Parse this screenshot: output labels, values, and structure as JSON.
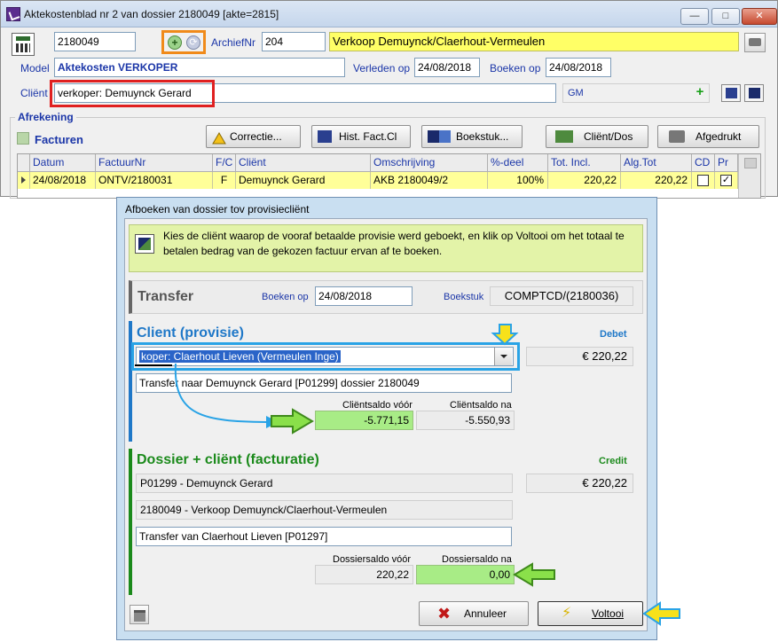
{
  "window": {
    "title": "Aktekostenblad nr 2 van dossier 2180049 [akte=2815]",
    "min_label": "0",
    "max_label": "1",
    "close_label": "r"
  },
  "header": {
    "dossier_nr": "2180049",
    "archief_label": "ArchiefNr",
    "archief_nr": "204",
    "dossier_title": "Verkoop Demuynck/Claerhout-Vermeulen",
    "model_label": "Model",
    "model_value": "Aktekosten VERKOPER",
    "verleden_label": "Verleden op",
    "verleden_value": "24/08/2018",
    "boeken_label": "Boeken op",
    "boeken_value": "24/08/2018",
    "client_label": "Cliënt",
    "client_value": "verkoper: Demuynck Gerard",
    "client_code": "GM"
  },
  "afrekening": {
    "group_label": "Afrekening",
    "facturen_label": "Facturen",
    "buttons": {
      "correctie": "Correctie...",
      "hist": "Hist. Fact.Cl",
      "boekstuk": "Boekstuk...",
      "client_dos": "Cliënt/Dos",
      "afgedrukt": "Afgedrukt"
    },
    "columns": [
      "Datum",
      "FactuurNr",
      "F/C",
      "Cliënt",
      "Omschrijving",
      "%-deel",
      "Tot. Incl.",
      "Alg.Tot",
      "CD",
      "Pr"
    ],
    "row": {
      "datum": "24/08/2018",
      "factuurnr": "ONTV/2180031",
      "fc": "F",
      "client": "Demuynck Gerard",
      "omschrijving": "AKB 2180049/2",
      "deel": "100%",
      "tot_incl": "220,22",
      "alg_tot": "220,22",
      "cd": false,
      "pr": true
    }
  },
  "dialog": {
    "title": "Afboeken van dossier tov provisiecliënt",
    "info": "Kies de cliënt waarop de vooraf betaalde provisie werd geboekt, en klik op Voltooi om het totaal te betalen bedrag van de gekozen factuur ervan af te boeken.",
    "transfer_label": "Transfer",
    "boeken_label": "Boeken op",
    "boeken_value": "24/08/2018",
    "boekstuk_label": "Boekstuk",
    "boekstuk_value": "COMPTCD/(2180036)",
    "client_section": {
      "title": "Client (provisie)",
      "debet_label": "Debet",
      "selected_client": "koper: Claerhout Lieven (Vermeulen Inge)",
      "debet_value": "€ 220,22",
      "description": "Transfer naar Demuynck Gerard [P01299] dossier 2180049",
      "saldo_voor_label": "Cliëntsaldo vóór",
      "saldo_na_label": "Cliëntsaldo na",
      "saldo_voor": "-5.771,15",
      "saldo_na": "-5.550,93"
    },
    "dossier_section": {
      "title": "Dossier + cliënt (facturatie)",
      "credit_label": "Credit",
      "client": "P01299 - Demuynck Gerard",
      "credit_value": "€ 220,22",
      "dossier": "2180049 - Verkoop Demuynck/Claerhout-Vermeulen",
      "description": "Transfer van Claerhout Lieven [P01297]",
      "saldo_voor_label": "Dossiersaldo vóór",
      "saldo_na_label": "Dossiersaldo na",
      "saldo_voor": "220,22",
      "saldo_na": "0,00"
    },
    "cancel_label": "Annuleer",
    "finish_label": "Voltooi"
  },
  "colors": {
    "highlight_yellow": "#ffff99",
    "green_field": "#a8ec86",
    "callout_blue": "#29a3e6",
    "callout_red": "#e02020",
    "callout_orange": "#f08a1a",
    "arrow_green": "#7cd03a",
    "arrow_yellow": "#f7e11b",
    "client_blue": "#1f78c8",
    "dossier_green": "#1b8a1b"
  }
}
